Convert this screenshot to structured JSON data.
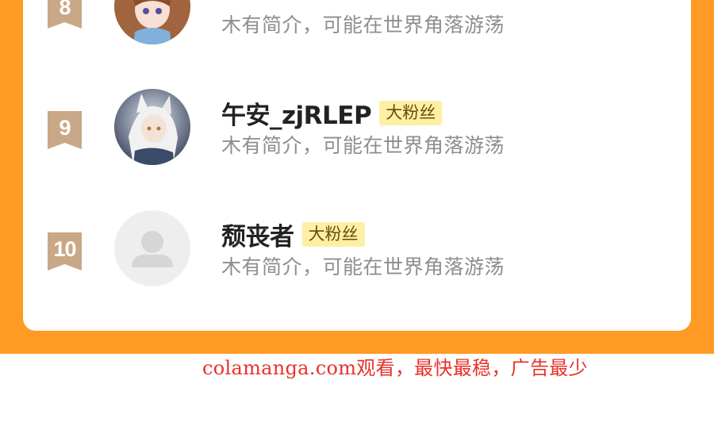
{
  "ranking": {
    "items": [
      {
        "rank": "8",
        "name": "",
        "badge": "",
        "intro": "木有简介，可能在世界角落游荡",
        "avatar": "anime-girl-avatar"
      },
      {
        "rank": "9",
        "name": "午安_zjRLEP",
        "badge": "大粉丝",
        "intro": "木有简介，可能在世界角落游荡",
        "avatar": "anime-wolf-girl-avatar"
      },
      {
        "rank": "10",
        "name": "颓丧者",
        "badge": "大粉丝",
        "intro": "木有简介，可能在世界角落游荡",
        "avatar": "default-user-icon"
      }
    ]
  },
  "footer": {
    "ad_text": "colamanga.com观看，最快最稳，广告最少"
  },
  "colors": {
    "background_orange": "#ff9a24",
    "rank_badge": "#c9a888",
    "fan_badge_bg": "#fdf0a3",
    "ad_red": "#e8322a"
  }
}
